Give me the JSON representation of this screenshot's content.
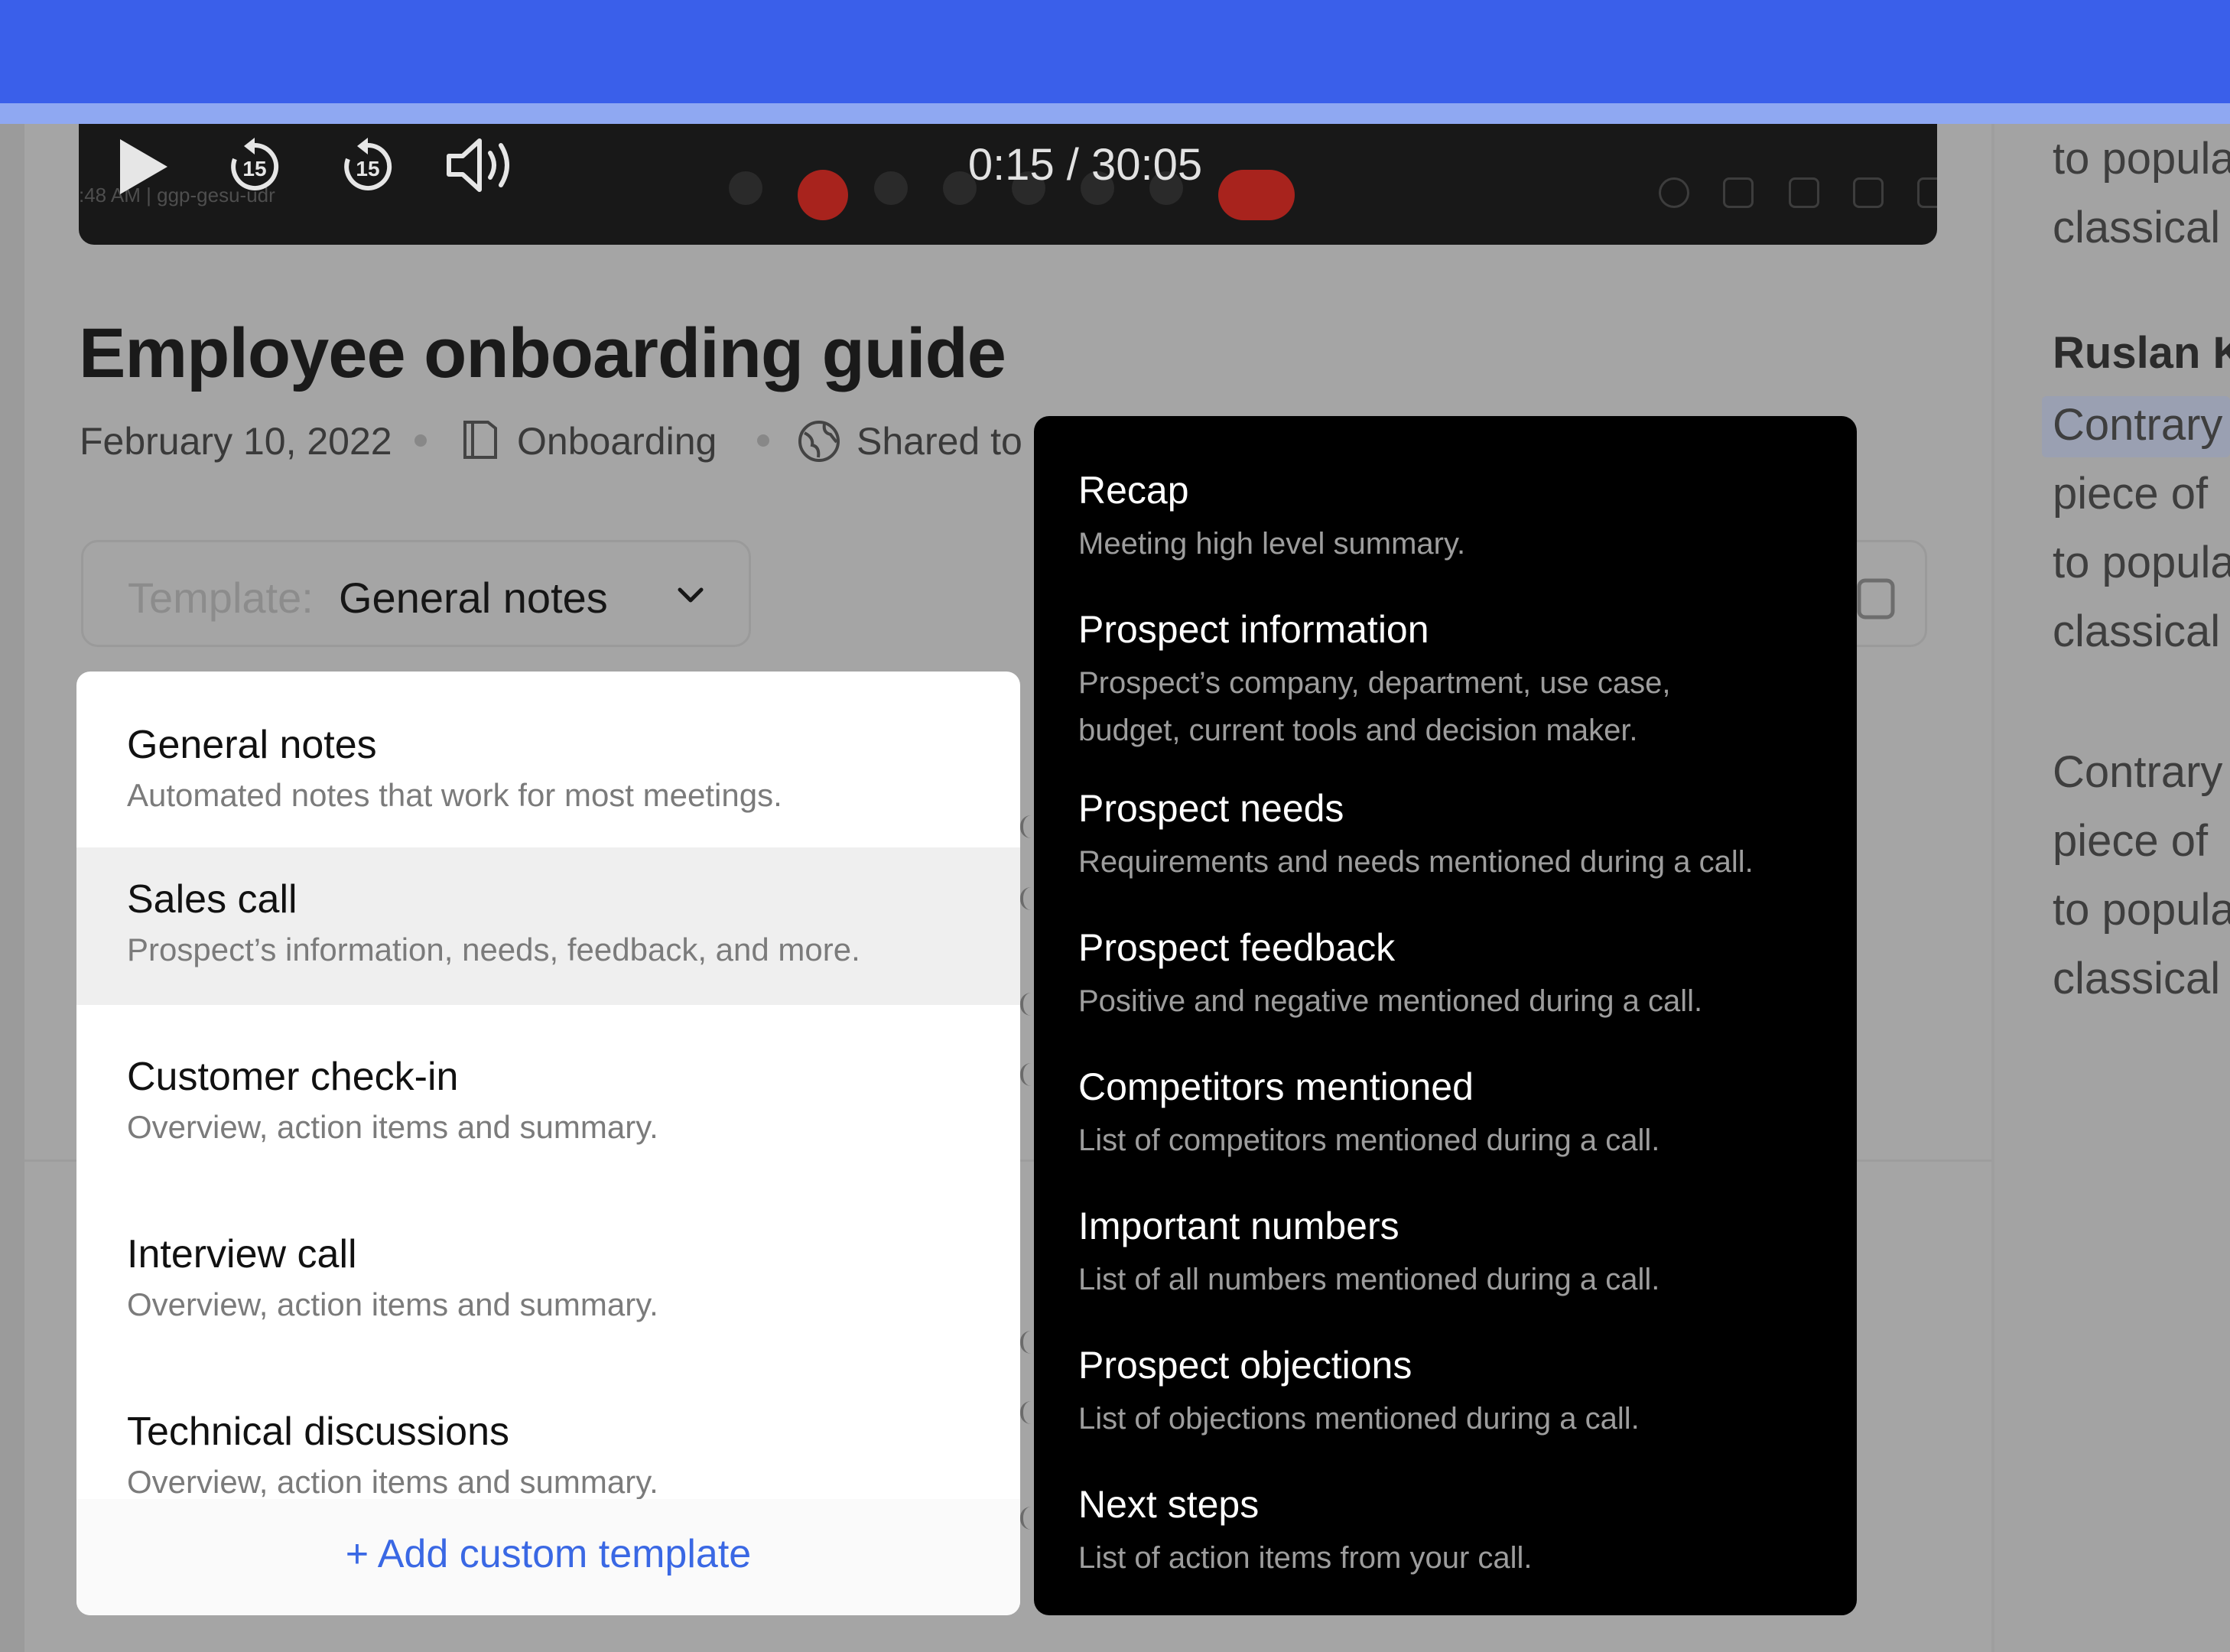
{
  "player": {
    "time": "0:15 / 30:05",
    "meeting_sub": ":48 AM  |  ggp-gesu-udr",
    "rewind_seconds": "15",
    "forward_seconds": "15"
  },
  "doc": {
    "title": "Employee onboarding guide",
    "date": "February 10, 2022",
    "folder": "Onboarding",
    "shared": "Shared to"
  },
  "template_selector": {
    "label": "Template:",
    "value": "General notes"
  },
  "menu": {
    "items": [
      {
        "title": "General notes",
        "desc": "Automated notes that work for most meetings."
      },
      {
        "title": "Sales call",
        "desc": "Prospect’s information, needs, feedback, and more."
      },
      {
        "title": "Customer check-in",
        "desc": "Overview, action items and summary."
      },
      {
        "title": "Interview call",
        "desc": "Overview, action items and summary."
      },
      {
        "title": "Technical discussions",
        "desc": "Overview, action items and summary."
      }
    ],
    "selected_index": 1,
    "add_label": "+ Add custom template"
  },
  "preview": {
    "sections": [
      {
        "title": "Recap",
        "desc": "Meeting high level summary."
      },
      {
        "title": "Prospect information",
        "desc": "Prospect’s company, department, use case,",
        "desc2": "budget, current tools and decision maker."
      },
      {
        "title": "Prospect needs",
        "desc": "Requirements and needs mentioned during a call."
      },
      {
        "title": "Prospect feedback",
        "desc": "Positive and negative mentioned during a call."
      },
      {
        "title": "Competitors mentioned",
        "desc": "List of competitors mentioned during a call."
      },
      {
        "title": "Important numbers",
        "desc": "List of all numbers mentioned during a call."
      },
      {
        "title": "Prospect objections",
        "desc": "List of objections mentioned during a call."
      },
      {
        "title": "Next steps",
        "desc": "List of action items from your call."
      }
    ]
  },
  "right_pane": {
    "lines": [
      "to popula",
      "classical",
      "Ruslan K",
      "Contrary",
      "piece of",
      "to popula",
      "classical",
      "Contrary",
      "piece of",
      "to popula",
      "classical"
    ]
  },
  "colors": {
    "top_band": "#3a5fea",
    "accent_link": "#3a68e4",
    "selected_row": "#efefef",
    "end_call_red": "#a8231d"
  }
}
